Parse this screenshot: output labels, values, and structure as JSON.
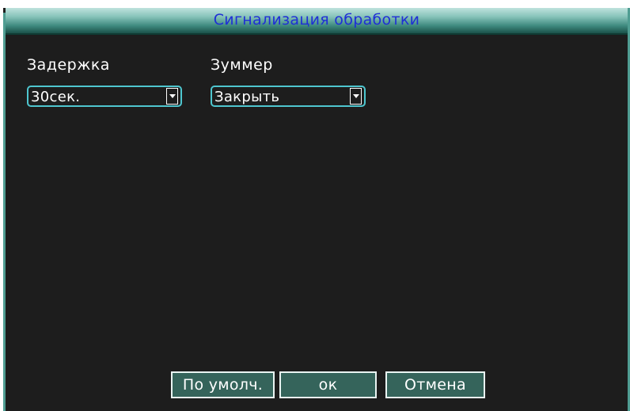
{
  "dialog": {
    "title": "Сигнализация обработки"
  },
  "fields": {
    "delay": {
      "label": "Задержка",
      "value": "30сек."
    },
    "buzzer": {
      "label": "Зуммер",
      "value": "Закрыть"
    }
  },
  "buttons": {
    "default": "По умолч.",
    "ok": "ок",
    "cancel": "Отмена"
  },
  "icons": {
    "dropdown": "chevron-down-icon"
  },
  "colors": {
    "title_text": "#1f2fd6",
    "background": "#1d1d1d",
    "border_accent": "#4f9d92",
    "select_border": "#4ec6cf",
    "button_fill": "#35645b"
  }
}
